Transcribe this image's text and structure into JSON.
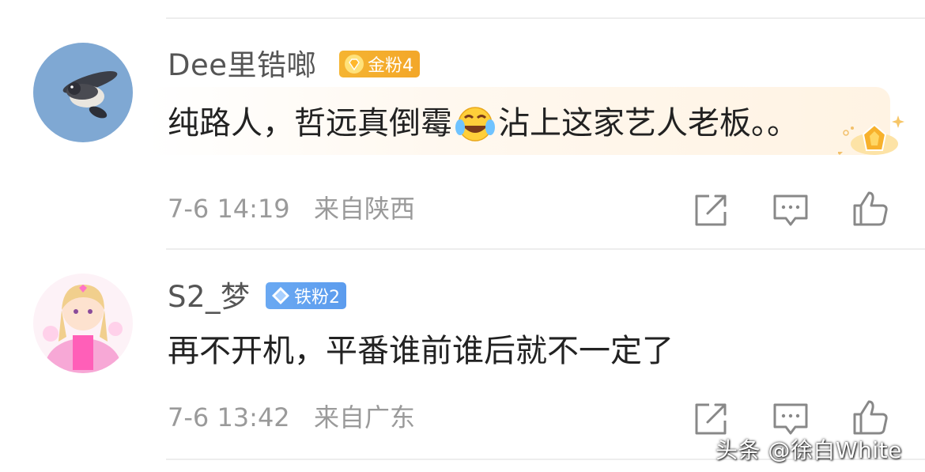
{
  "comments": [
    {
      "username": "Dee里锆啷",
      "badge": {
        "label": "金粉4",
        "color": "#f3a72a"
      },
      "text_before": "纯路人，哲远真倒霉",
      "emoji": "laughing-crying-face",
      "text_after": "沾上这家艺人老板。。",
      "date": "7-6 14:19",
      "location": "来自陕西",
      "has_highlight": true
    },
    {
      "username": "S2_梦",
      "badge": {
        "label": "铁粉2",
        "color": "#5c9cee"
      },
      "text": "再不开机，平番谁前谁后就不一定了",
      "date": "7-6 13:42",
      "location": "来自广东"
    }
  ],
  "watermark": "头条 @徐白White",
  "icons": [
    "share-icon",
    "comment-icon",
    "like-icon",
    "crown-badge-icon"
  ]
}
